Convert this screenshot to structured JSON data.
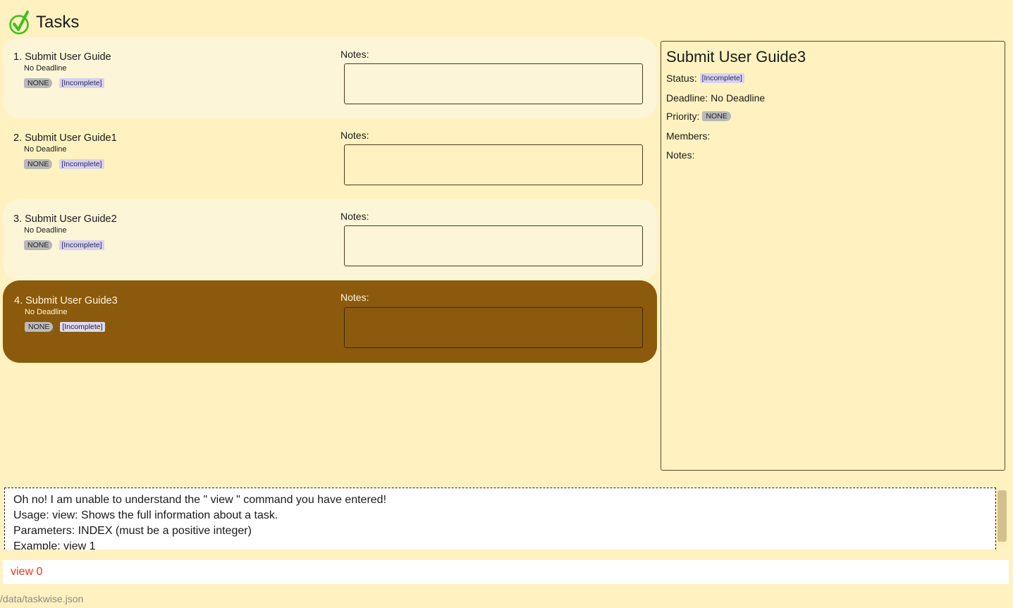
{
  "header": {
    "title": "Tasks",
    "icon": "checkmark-icon"
  },
  "tasks": [
    {
      "title": "1. Submit User Guide",
      "deadline": "No Deadline",
      "priority": "NONE",
      "status": "[Incomplete]",
      "notes_label": "Notes:"
    },
    {
      "title": "2. Submit User Guide1",
      "deadline": "No Deadline",
      "priority": "NONE",
      "status": "[Incomplete]",
      "notes_label": "Notes:"
    },
    {
      "title": "3. Submit User Guide2",
      "deadline": "No Deadline",
      "priority": "NONE",
      "status": "[Incomplete]",
      "notes_label": "Notes:"
    },
    {
      "title": "4. Submit User Guide3",
      "deadline": "No Deadline",
      "priority": "NONE",
      "status": "[Incomplete]",
      "notes_label": "Notes:"
    }
  ],
  "detail": {
    "title": "Submit User Guide3",
    "status_label": "Status:",
    "status": "[Incomplete]",
    "deadline_label": "Deadline:",
    "deadline": "No Deadline",
    "priority_label": "Priority:",
    "priority": "NONE",
    "members_label": "Members:",
    "notes_label": "Notes:"
  },
  "result": {
    "lines": [
      "Oh no! I am unable to understand the  \" view \" command you have entered!",
      "Usage: view: Shows the full information about a task.",
      "Parameters: INDEX (must be a positive integer)",
      "Example: view 1"
    ]
  },
  "command": {
    "value": "view 0"
  },
  "status_bar": {
    "path": "/data/taskwise.json"
  },
  "colors": {
    "background": "#fff2c0",
    "selected_card": "#8b5a0c",
    "command_error": "#e8361c",
    "check_icon": "#3fbf1f"
  }
}
